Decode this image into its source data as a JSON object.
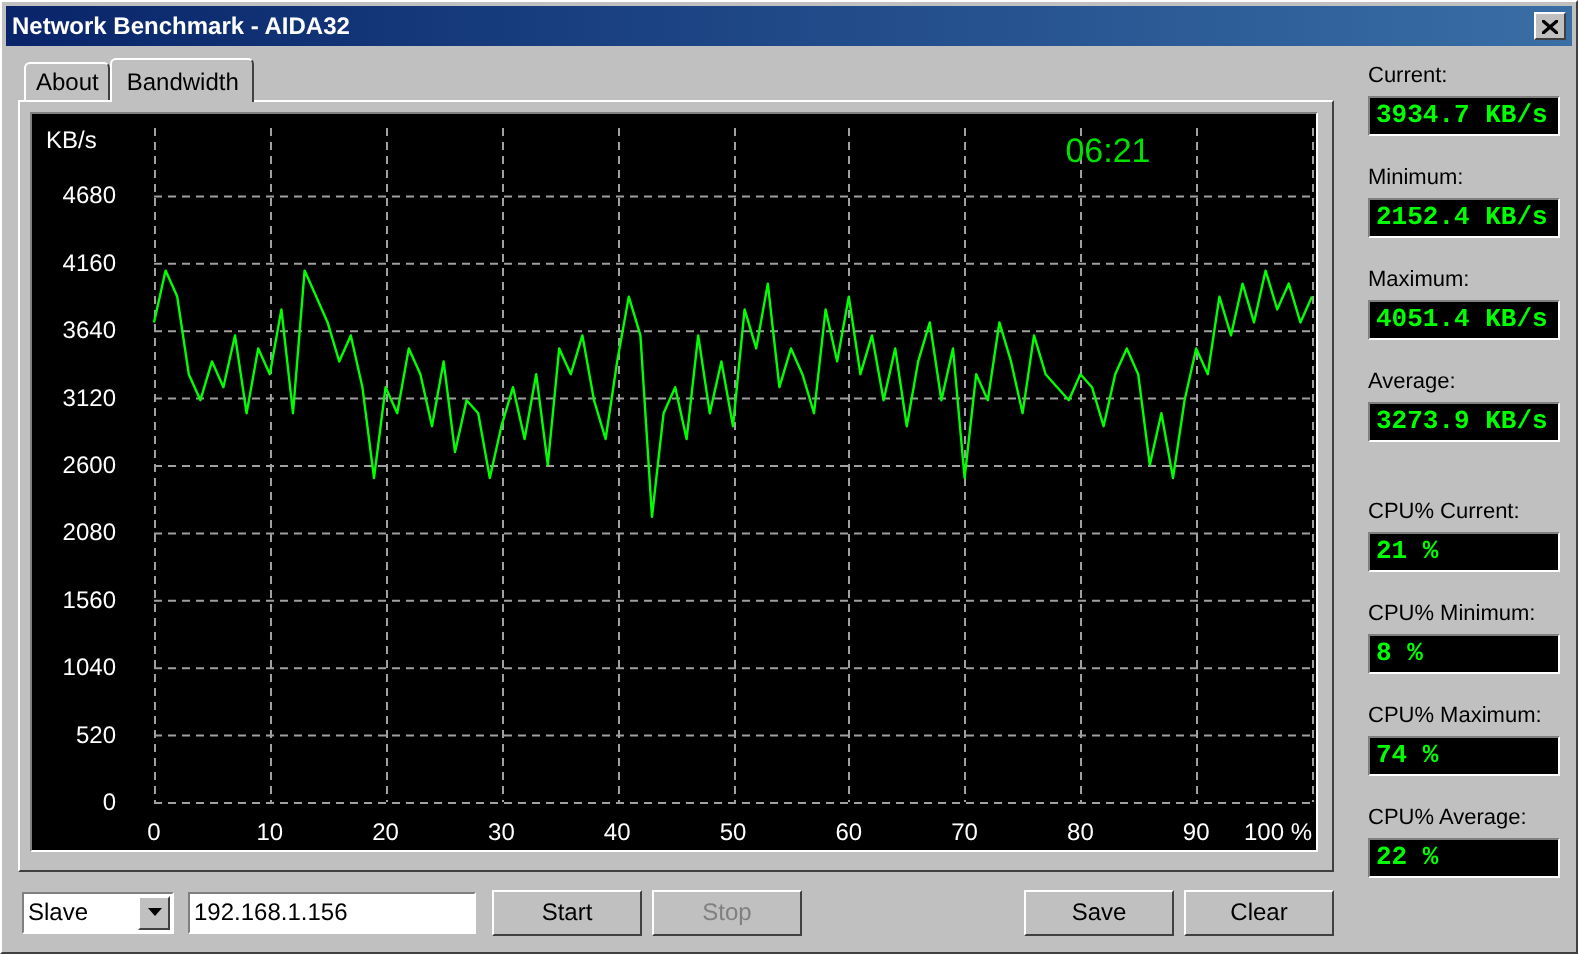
{
  "window": {
    "title": "Network Benchmark - AIDA32"
  },
  "tabs": [
    {
      "label": "About",
      "selected": false
    },
    {
      "label": "Bandwidth",
      "selected": true
    }
  ],
  "chart": {
    "timer": "06:21",
    "chart_data": {
      "type": "line",
      "ylabel": "KB/s",
      "ylim": [
        0,
        5200
      ],
      "xlim": [
        0,
        100
      ],
      "yticks": [
        0,
        520,
        1040,
        1560,
        2080,
        2600,
        3120,
        3640,
        4160,
        4680
      ],
      "xticks": [
        0,
        10,
        20,
        30,
        40,
        50,
        60,
        70,
        80,
        90,
        {
          "value": 100,
          "label": "100 %"
        }
      ],
      "x": [
        0,
        1,
        2,
        3,
        4,
        5,
        6,
        7,
        8,
        9,
        10,
        11,
        12,
        13,
        14,
        15,
        16,
        17,
        18,
        19,
        20,
        21,
        22,
        23,
        24,
        25,
        26,
        27,
        28,
        29,
        30,
        31,
        32,
        33,
        34,
        35,
        36,
        37,
        38,
        39,
        40,
        41,
        42,
        43,
        44,
        45,
        46,
        47,
        48,
        49,
        50,
        51,
        52,
        53,
        54,
        55,
        56,
        57,
        58,
        59,
        60,
        61,
        62,
        63,
        64,
        65,
        66,
        67,
        68,
        69,
        70,
        71,
        72,
        73,
        74,
        75,
        76,
        77,
        78,
        79,
        80,
        81,
        82,
        83,
        84,
        85,
        86,
        87,
        88,
        89,
        90,
        91,
        92,
        93,
        94,
        95,
        96,
        97,
        98,
        99,
        100
      ],
      "grid": true,
      "series": [
        {
          "color": "#00ff00",
          "values": [
            3700,
            4100,
            3900,
            3300,
            3100,
            3400,
            3200,
            3600,
            3000,
            3500,
            3300,
            3800,
            3000,
            4100,
            3900,
            3700,
            3400,
            3600,
            3200,
            2500,
            3200,
            3000,
            3500,
            3300,
            2900,
            3400,
            2700,
            3100,
            3000,
            2500,
            2900,
            3200,
            2800,
            3300,
            2600,
            3500,
            3300,
            3600,
            3100,
            2800,
            3400,
            3900,
            3600,
            2200,
            3000,
            3200,
            2800,
            3600,
            3000,
            3400,
            2900,
            3800,
            3500,
            4000,
            3200,
            3500,
            3300,
            3000,
            3800,
            3400,
            3900,
            3300,
            3600,
            3100,
            3500,
            2900,
            3400,
            3700,
            3100,
            3500,
            2500,
            3300,
            3100,
            3700,
            3400,
            3000,
            3600,
            3300,
            3200,
            3100,
            3300,
            3200,
            2900,
            3300,
            3500,
            3300,
            2600,
            3000,
            2500,
            3100,
            3500,
            3300,
            3900,
            3600,
            4000,
            3700,
            4100,
            3800,
            4000,
            3700,
            3900
          ]
        }
      ]
    }
  },
  "stats": [
    {
      "label": "Current:",
      "value": "3934.7 KB/s"
    },
    {
      "label": "Minimum:",
      "value": "2152.4 KB/s"
    },
    {
      "label": "Maximum:",
      "value": "4051.4 KB/s"
    },
    {
      "label": "Average:",
      "value": "3273.9 KB/s"
    },
    {
      "label": "CPU% Current:",
      "value": "21 %"
    },
    {
      "label": "CPU% Minimum:",
      "value": "8 %"
    },
    {
      "label": "CPU% Maximum:",
      "value": "74 %"
    },
    {
      "label": "CPU% Average:",
      "value": "22 %"
    }
  ],
  "mode_select": {
    "value": "Slave"
  },
  "address_field": {
    "value": "192.168.1.156"
  },
  "buttons": [
    {
      "label": "Start",
      "disabled": false
    },
    {
      "label": "Stop",
      "disabled": true
    },
    {
      "label": "Save",
      "disabled": false
    },
    {
      "label": "Clear",
      "disabled": false
    }
  ]
}
